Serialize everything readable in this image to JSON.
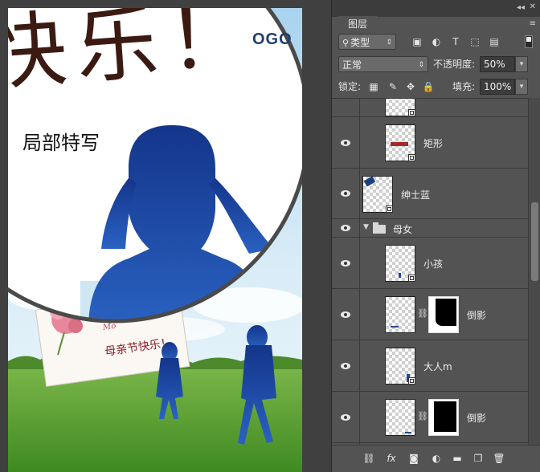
{
  "canvas": {
    "logo": "OGO",
    "magnifier_label": "局部特写",
    "big_calligraphy": "快乐！",
    "card_title": "母亲节快乐！",
    "card_subtitle": "Mo"
  },
  "panel": {
    "tab": "图层",
    "filter_select": "类型",
    "blend_mode": "正常",
    "opacity_label": "不透明度:",
    "opacity_value": "50%",
    "lock_label": "锁定:",
    "fill_label": "填充:",
    "fill_value": "100%"
  },
  "layers": [
    {
      "name": "",
      "visible": false
    },
    {
      "name": "矩形",
      "visible": true
    },
    {
      "name": "绅士蓝",
      "visible": true
    },
    {
      "name": "母女",
      "visible": true,
      "type": "group",
      "expanded": true
    },
    {
      "name": "小孩",
      "visible": true
    },
    {
      "name": "倒影",
      "visible": true,
      "has_mask": true
    },
    {
      "name": "大人m",
      "visible": true
    },
    {
      "name": "倒影",
      "visible": true,
      "has_mask": true
    }
  ],
  "icons": {
    "link_layers": "link-icon",
    "add_style": "fx",
    "add_mask": "mask-icon",
    "adjustment": "adjustment-icon",
    "new_group": "folder-icon",
    "new_layer": "new-layer-icon",
    "delete": "trash-icon"
  },
  "colors": {
    "panel_bg": "#535353",
    "panel_dark": "#3c3c3c",
    "silhouette_blue": "#1b4aa0",
    "grass_green": "#5a9a36",
    "sky_blue": "#8ec3e8",
    "rect_red": "#a22a2a"
  }
}
